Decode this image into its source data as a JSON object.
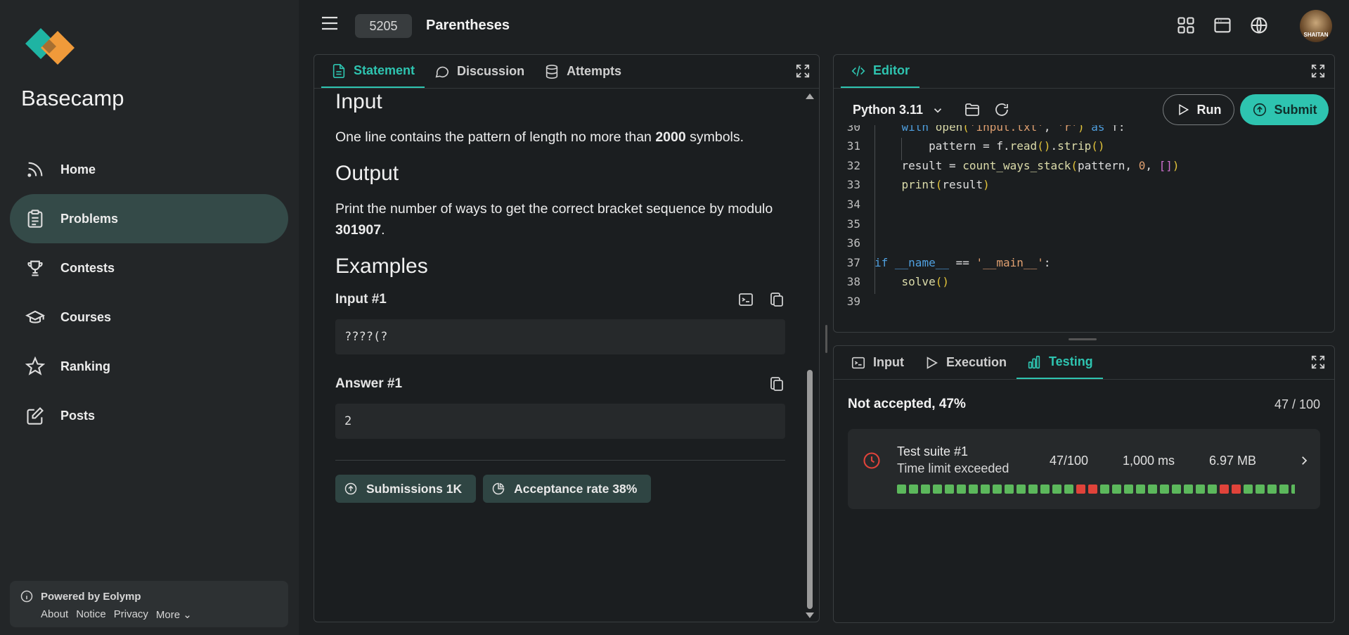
{
  "brand": {
    "name": "Basecamp",
    "colors": {
      "primary": "#1fb4a3",
      "secondary": "#f09a3a"
    }
  },
  "sidebar": {
    "items": [
      {
        "label": "Home",
        "icon": "rss-icon"
      },
      {
        "label": "Problems",
        "icon": "clipboard-icon",
        "active": true
      },
      {
        "label": "Contests",
        "icon": "trophy-icon"
      },
      {
        "label": "Courses",
        "icon": "graduation-cap-icon"
      },
      {
        "label": "Ranking",
        "icon": "star-icon"
      },
      {
        "label": "Posts",
        "icon": "edit-icon"
      }
    ],
    "footer": {
      "powered": "Powered by Eolymp",
      "links": [
        "About",
        "Notice",
        "Privacy",
        "More"
      ]
    }
  },
  "header": {
    "problem_id": "5205",
    "problem_title": "Parentheses",
    "avatar_text": "SHAITAN"
  },
  "statement": {
    "tabs": [
      "Statement",
      "Discussion",
      "Attempts"
    ],
    "input_heading": "Input",
    "input_text_pre": "One line contains the pattern of length no more than ",
    "input_text_bold": "2000",
    "input_text_post": " symbols.",
    "output_heading": "Output",
    "output_text_pre": "Print the number of ways to get the correct bracket sequence by modulo ",
    "output_text_bold": "301907",
    "output_text_post": ".",
    "examples_heading": "Examples",
    "input_ex_label": "Input #1",
    "input_ex_value": "????(?",
    "answer_ex_label": "Answer #1",
    "answer_ex_value": "2",
    "submissions": "Submissions 1K",
    "acceptance": "Acceptance rate 38%"
  },
  "editor": {
    "tab": "Editor",
    "language": "Python 3.11",
    "run": "Run",
    "submit": "Submit",
    "lines": [
      {
        "n": "30",
        "html": "    <span class=\"k\">with</span> <span class=\"f\">open</span><span class=\"y\">(</span><span class=\"s\">'input.txt'</span>, <span class=\"s\">'r'</span><span class=\"y\">)</span> <span class=\"k\">as</span> f:"
      },
      {
        "n": "31",
        "html": "        pattern = f.<span class=\"f\">read</span><span class=\"y\">()</span>.<span class=\"f\">strip</span><span class=\"y\">()</span>"
      },
      {
        "n": "32",
        "html": "    result = <span class=\"f\">count_ways_stack</span><span class=\"y\">(</span>pattern, <span class=\"s\">0</span>, <span class=\"p\">[]</span><span class=\"y\">)</span>"
      },
      {
        "n": "33",
        "html": "    <span class=\"f\">print</span><span class=\"y\">(</span>result<span class=\"y\">)</span>"
      },
      {
        "n": "34",
        "html": ""
      },
      {
        "n": "35",
        "html": ""
      },
      {
        "n": "36",
        "html": ""
      },
      {
        "n": "37",
        "html": "<span class=\"k\">if</span> <span class=\"k\">__name__</span> == <span class=\"s\">'__main__'</span>:"
      },
      {
        "n": "38",
        "html": "    <span class=\"f\">solve</span><span class=\"y\">()</span>"
      },
      {
        "n": "39",
        "html": ""
      }
    ]
  },
  "testing": {
    "tabs": [
      "Input",
      "Execution",
      "Testing"
    ],
    "status": "Not accepted, 47%",
    "score": "47 / 100",
    "suite": {
      "name": "Test suite #1",
      "result": "Time limit exceeded",
      "points": "47/100",
      "time": "1,000 ms",
      "memory": "6.97 MB",
      "tests": [
        "pass",
        "pass",
        "pass",
        "pass",
        "pass",
        "pass",
        "pass",
        "pass",
        "pass",
        "pass",
        "pass",
        "pass",
        "pass",
        "pass",
        "pass",
        "fail",
        "fail",
        "pass",
        "pass",
        "pass",
        "pass",
        "pass",
        "pass",
        "pass",
        "pass",
        "pass",
        "pass",
        "fail",
        "fail",
        "pass",
        "pass",
        "pass",
        "pass",
        "pass",
        "pass",
        "fail"
      ]
    }
  },
  "colors": {
    "accent": "#2ec4b0",
    "pass": "#5cb85c",
    "fail": "#e0433a"
  }
}
